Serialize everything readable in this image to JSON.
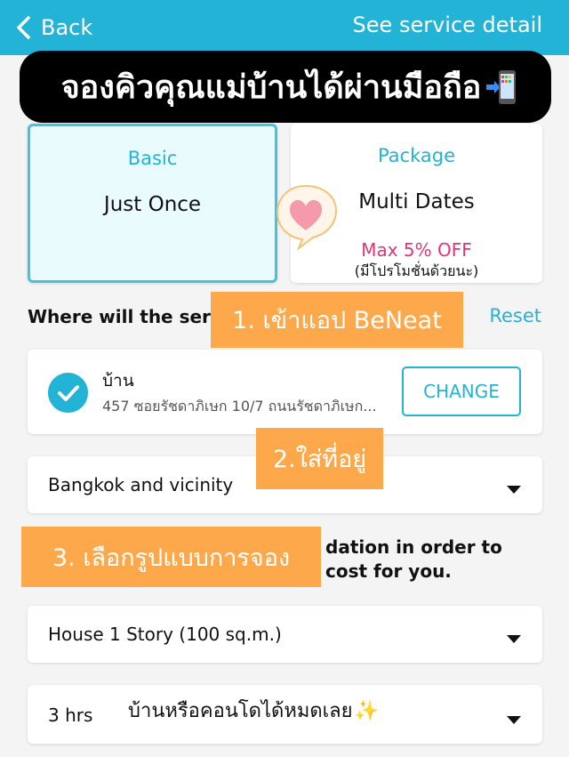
{
  "header": {
    "back_label": "Back",
    "detail_link": "See service detail",
    "bg_color": "#23b3d6"
  },
  "banner": {
    "title": "จองคิวคุณแม่บ้านได้ผ่านมือถือ",
    "icon": "mobile-phone-arrow-icon"
  },
  "options": [
    {
      "kicker": "Basic",
      "title": "Just Once",
      "selected": true
    },
    {
      "kicker": "Package",
      "title": "Multi Dates",
      "discount": "Max 5% OFF",
      "promo": "(มีโปรโมชั่นด้วยนะ)",
      "selected": false
    }
  ],
  "location": {
    "question": "Where will the servi",
    "reset_label": "Reset",
    "address_name": "บ้าน",
    "address_line": "457 ซอยรัชดาภิเษก 10/7 ถนนรัชดาภิเษก...",
    "change_label": "CHANGE",
    "region": "Bangkok and vicinity"
  },
  "info": {
    "line1": "dation in order to",
    "line2": "cost for you."
  },
  "selects": {
    "house_type": "House 1 Story (100 sq.m.)",
    "duration": "3 hrs"
  },
  "overlays": {
    "step1": "1. เข้าแอป BeNeat",
    "step2": "2.ใส่ที่อยู่",
    "step3": "3. เลือกรูปแบบการจอง",
    "caption": "บ้านหรือคอนโดได้หมดเลย",
    "caption_icon": "sparkles-icon",
    "accent_orange": "#fda84a",
    "accent_pink": "#e0347a"
  }
}
